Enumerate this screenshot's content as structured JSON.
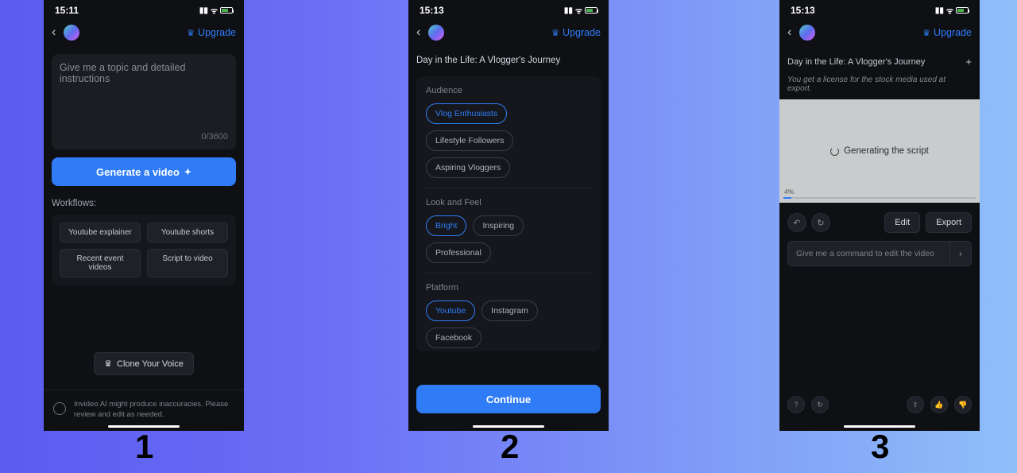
{
  "screen1": {
    "status_time": "15:11",
    "upgrade": "Upgrade",
    "topic_placeholder": "Give me a topic and detailed instructions",
    "char_count": "0/3600",
    "generate_label": "Generate a video",
    "workflows_label": "Workflows:",
    "workflows": [
      "Youtube explainer",
      "Youtube shorts",
      "Recent event videos",
      "Script to video"
    ],
    "clone_voice": "Clone Your Voice",
    "disclaimer": "Invideo AI might produce inaccuracies. Please review and edit as needed."
  },
  "screen2": {
    "status_time": "15:13",
    "upgrade": "Upgrade",
    "title": "Day in the Life: A Vlogger's Journey",
    "sections": {
      "audience": {
        "label": "Audience",
        "chips": [
          "Vlog Enthusiasts",
          "Lifestyle Followers",
          "Aspiring Vloggers"
        ],
        "active": 0
      },
      "look": {
        "label": "Look and Feel",
        "chips": [
          "Bright",
          "Inspiring",
          "Professional"
        ],
        "active": 0
      },
      "platform": {
        "label": "Platform",
        "chips": [
          "Youtube",
          "Instagram",
          "Facebook"
        ],
        "active": 0
      }
    },
    "continue_label": "Continue"
  },
  "screen3": {
    "status_time": "15:13",
    "upgrade": "Upgrade",
    "title": "Day in the Life: A Vlogger's Journey",
    "license_note": "You get a license for the stock media used at export.",
    "generating_label": "Generating the script",
    "progress_pct": "4%",
    "edit_label": "Edit",
    "export_label": "Export",
    "command_placeholder": "Give me a command to edit the video"
  },
  "step_numbers": [
    "1",
    "2",
    "3"
  ]
}
